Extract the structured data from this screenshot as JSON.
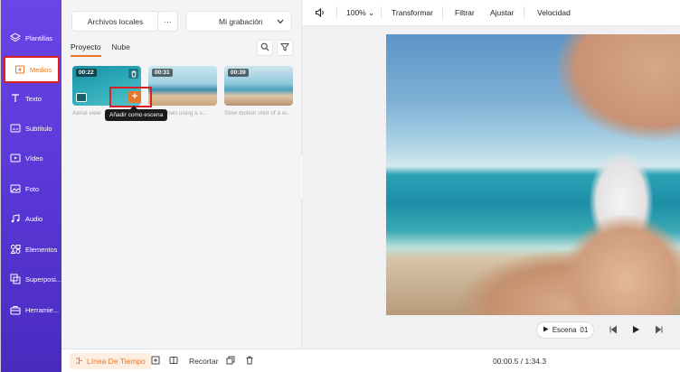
{
  "colors": {
    "sidebar_top": "#6b45e6",
    "sidebar_bottom": "#4a2bbf",
    "accent": "#e8772e",
    "highlight": "#d81f26"
  },
  "sidebar": {
    "items": [
      {
        "label": "Plantillas",
        "icon": "layers-icon"
      },
      {
        "label": "Medios",
        "icon": "media-import-icon",
        "active": true
      },
      {
        "label": "Texto",
        "icon": "text-icon"
      },
      {
        "label": "Subtítulo",
        "icon": "subtitle-icon"
      },
      {
        "label": "Vídeo",
        "icon": "video-icon"
      },
      {
        "label": "Foto",
        "icon": "photo-icon"
      },
      {
        "label": "Audio",
        "icon": "music-icon"
      },
      {
        "label": "Elementos",
        "icon": "elements-icon"
      },
      {
        "label": "Superposi...",
        "icon": "overlay-icon"
      },
      {
        "label": "Herramie...",
        "icon": "toolbox-icon"
      }
    ]
  },
  "panel": {
    "local_files_label": "Archivos locales",
    "more_label": "···",
    "recording_select": "Mi grabación",
    "tabs": [
      {
        "label": "Proyecto",
        "active": true
      },
      {
        "label": "Nube"
      }
    ],
    "media": [
      {
        "duration": "00:22",
        "title": "Aerial view"
      },
      {
        "duration": "00:31",
        "title": "woman using a s..."
      },
      {
        "duration": "00:39",
        "title": "Slow motion shot of a w..."
      }
    ],
    "tooltip": "Añadir como escena",
    "add_label": "+"
  },
  "toolbar": {
    "zoom": "100%",
    "transform": "Transformar",
    "filter": "Filtrar",
    "adjust": "Ajustar",
    "speed": "Velocidad"
  },
  "player": {
    "scene_label": "Escena",
    "scene_number": "01"
  },
  "bottombar": {
    "timeline_label": "Línea De Tiempo",
    "crop_label": "Recortar",
    "time": "00:00.5 / 1:34.3"
  }
}
